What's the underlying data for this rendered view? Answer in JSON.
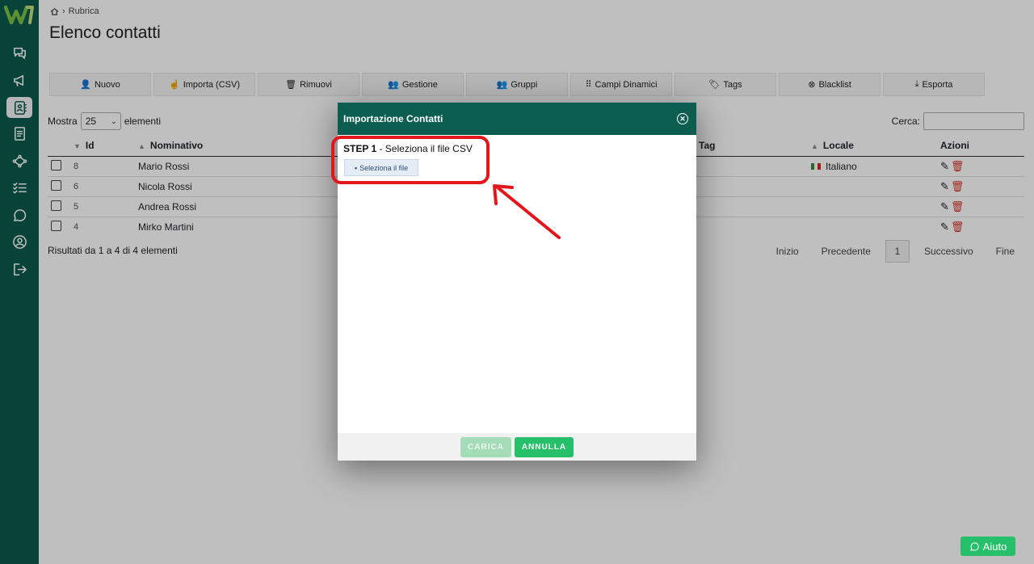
{
  "breadcrumb": {
    "label": "Rubrica"
  },
  "page": {
    "title": "Elenco contatti"
  },
  "toolbar": [
    {
      "label": "Nuovo",
      "icon": "user-plus-icon"
    },
    {
      "label": "Importa (CSV)",
      "icon": "hand-pointer-icon"
    },
    {
      "label": "Rimuovi",
      "icon": "trash-icon"
    },
    {
      "label": "Gestione",
      "icon": "users-icon"
    },
    {
      "label": "Gruppi",
      "icon": "user-group-icon"
    },
    {
      "label": "Campi Dinamici",
      "icon": "grid-icon"
    },
    {
      "label": "Tags",
      "icon": "tag-icon"
    },
    {
      "label": "Blacklist",
      "icon": "ban-icon"
    },
    {
      "label": "Esporta",
      "icon": "download-icon"
    }
  ],
  "table_controls": {
    "show_label": "Mostra",
    "page_length": "25",
    "elements_label": "elementi",
    "search_label": "Cerca:",
    "search_value": ""
  },
  "table": {
    "headers": {
      "id": "Id",
      "name": "Nominativo",
      "tag": "Tag",
      "locale": "Locale",
      "actions": "Azioni"
    },
    "rows": [
      {
        "id": "8",
        "name": "Mario Rossi",
        "locale": "Italiano"
      },
      {
        "id": "6",
        "name": "Nicola Rossi",
        "locale": ""
      },
      {
        "id": "5",
        "name": "Andrea Rossi",
        "locale": ""
      },
      {
        "id": "4",
        "name": "Mirko Martini",
        "locale": ""
      }
    ]
  },
  "results": {
    "text": "Risultati da 1 a 4 di 4 elementi"
  },
  "pagination": {
    "first": "Inizio",
    "prev": "Precedente",
    "current": "1",
    "next": "Successivo",
    "last": "Fine"
  },
  "modal": {
    "title": "Importazione Contatti",
    "step_label": "STEP 1",
    "step_text": " - Seleziona il file CSV",
    "file_button": "Seleziona il file",
    "upload_button": "CARICA",
    "cancel_button": "ANNULLA"
  },
  "help": {
    "label": "Aiuto"
  },
  "colors": {
    "sidebar": "#0a5a4b",
    "modal_header": "#0b5d50",
    "accent_green": "#27c06a",
    "highlight_red": "#e3161b"
  }
}
